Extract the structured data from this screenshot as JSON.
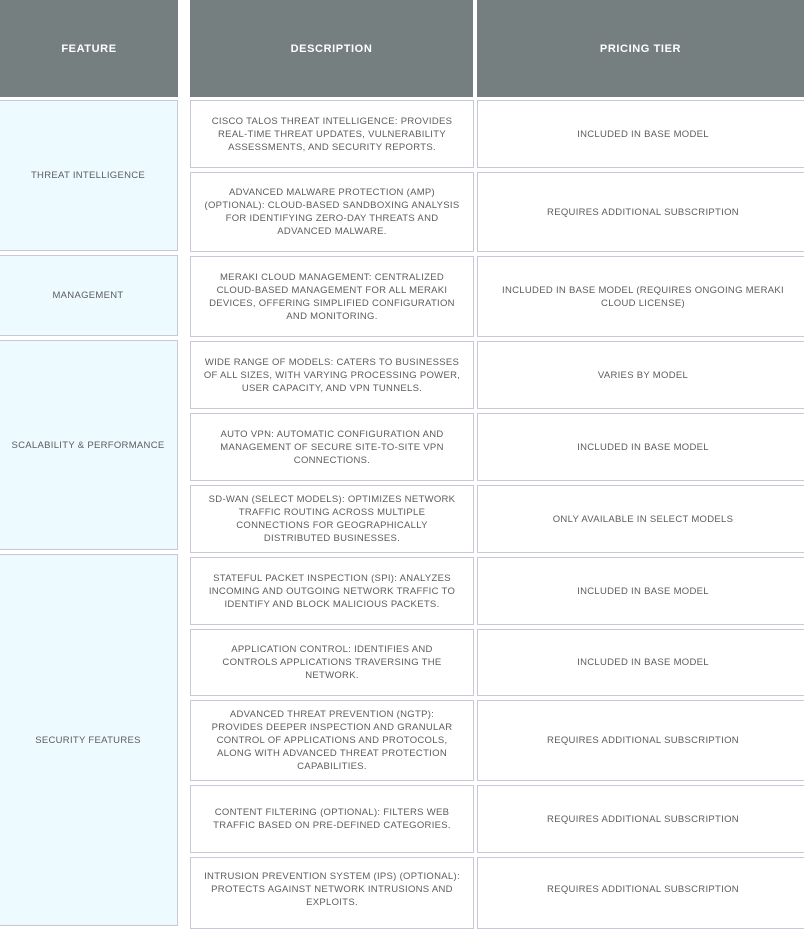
{
  "table": {
    "headers": [
      "FEATURE",
      "DESCRIPTION",
      "PRICING TIER"
    ],
    "groups": [
      {
        "feature": "THREAT INTELLIGENCE",
        "rows": [
          {
            "description": "CISCO TALOS THREAT INTELLIGENCE: PROVIDES REAL-TIME THREAT UPDATES, VULNERABILITY ASSESSMENTS, AND SECURITY REPORTS.",
            "pricing": "INCLUDED IN BASE MODEL"
          },
          {
            "description": "ADVANCED MALWARE PROTECTION (AMP) (OPTIONAL): CLOUD-BASED SANDBOXING ANALYSIS FOR IDENTIFYING ZERO-DAY THREATS AND ADVANCED MALWARE.",
            "pricing": "REQUIRES ADDITIONAL SUBSCRIPTION"
          }
        ]
      },
      {
        "feature": "MANAGEMENT",
        "rows": [
          {
            "description": "MERAKI CLOUD MANAGEMENT: CENTRALIZED CLOUD-BASED MANAGEMENT FOR ALL MERAKI DEVICES, OFFERING SIMPLIFIED CONFIGURATION AND MONITORING.",
            "pricing": "INCLUDED IN BASE MODEL (REQUIRES ONGOING MERAKI CLOUD LICENSE)"
          }
        ]
      },
      {
        "feature": "SCALABILITY & PERFORMANCE",
        "rows": [
          {
            "description": "WIDE RANGE OF MODELS: CATERS TO BUSINESSES OF ALL SIZES, WITH VARYING PROCESSING POWER, USER CAPACITY, AND VPN TUNNELS.",
            "pricing": "VARIES BY MODEL"
          },
          {
            "description": "AUTO VPN: AUTOMATIC CONFIGURATION AND MANAGEMENT OF SECURE SITE-TO-SITE VPN CONNECTIONS.",
            "pricing": "INCLUDED IN BASE MODEL"
          },
          {
            "description": "SD-WAN (SELECT MODELS): OPTIMIZES NETWORK TRAFFIC ROUTING ACROSS MULTIPLE CONNECTIONS FOR GEOGRAPHICALLY DISTRIBUTED BUSINESSES.",
            "pricing": "ONLY AVAILABLE IN SELECT MODELS"
          }
        ]
      },
      {
        "feature": "SECURITY FEATURES",
        "rows": [
          {
            "description": "STATEFUL PACKET INSPECTION (SPI): ANALYZES INCOMING AND OUTGOING NETWORK TRAFFIC TO IDENTIFY AND BLOCK MALICIOUS PACKETS.",
            "pricing": "INCLUDED IN BASE MODEL"
          },
          {
            "description": "APPLICATION CONTROL: IDENTIFIES AND CONTROLS APPLICATIONS TRAVERSING THE NETWORK.",
            "pricing": "INCLUDED IN BASE MODEL"
          },
          {
            "description": "ADVANCED THREAT PREVENTION (NGTP): PROVIDES DEEPER INSPECTION AND GRANULAR CONTROL OF APPLICATIONS AND PROTOCOLS, ALONG WITH ADVANCED THREAT PROTECTION CAPABILITIES.",
            "pricing": "REQUIRES ADDITIONAL SUBSCRIPTION"
          },
          {
            "description": "CONTENT FILTERING (OPTIONAL): FILTERS WEB TRAFFIC BASED ON PRE-DEFINED CATEGORIES.",
            "pricing": "REQUIRES ADDITIONAL SUBSCRIPTION"
          },
          {
            "description": "INTRUSION PREVENTION SYSTEM (IPS) (OPTIONAL): PROTECTS AGAINST NETWORK INTRUSIONS AND EXPLOITS.",
            "pricing": "REQUIRES ADDITIONAL SUBSCRIPTION"
          }
        ]
      }
    ]
  }
}
